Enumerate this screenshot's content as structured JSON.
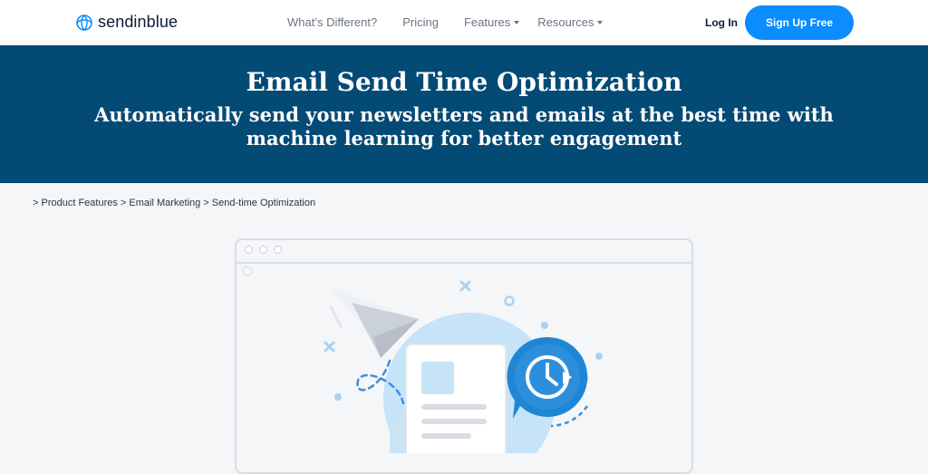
{
  "brand": {
    "name": "sendinblue",
    "color": "#0b8cff"
  },
  "nav": {
    "items": [
      {
        "label": "What’s Different?",
        "dropdown": false
      },
      {
        "label": "Pricing",
        "dropdown": false
      },
      {
        "label": "Features",
        "dropdown": true
      },
      {
        "label": "Resources",
        "dropdown": true
      }
    ],
    "login_label": "Log In",
    "signup_label": "Sign Up Free"
  },
  "hero": {
    "title": "Email Send Time Optimization",
    "subtitle": "Automatically send your newsletters and emails at the best time with machine learning for better engagement",
    "background": "#034a75"
  },
  "breadcrumb": {
    "text": "> Product Features > Email Marketing > Send-time Optimization"
  },
  "illustration": {
    "icons": [
      "paper-plane-icon",
      "email-document-icon",
      "clock-icon"
    ]
  }
}
